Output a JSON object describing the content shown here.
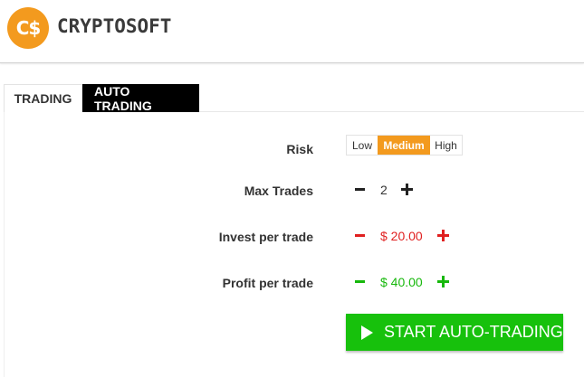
{
  "brand": {
    "badge": "C$",
    "name": "CRYPTOSOFT"
  },
  "tabs": [
    {
      "label": "TRADING",
      "active": false
    },
    {
      "label": "AUTO TRADING",
      "active": true
    }
  ],
  "settings": {
    "risk": {
      "label": "Risk",
      "options": [
        "Low",
        "Medium",
        "High"
      ],
      "selected": "Medium"
    },
    "max_trades": {
      "label": "Max Trades",
      "value": "2"
    },
    "invest": {
      "label": "Invest per trade",
      "value": "$ 20.00"
    },
    "profit": {
      "label": "Profit per trade",
      "value": "$ 40.00"
    }
  },
  "start_button": {
    "label": "START AUTO-TRADING"
  },
  "colors": {
    "accent_orange": "#f39a1e",
    "invest_red": "#e02020",
    "profit_green": "#17b80c",
    "button_green": "#17c10c"
  },
  "icons": [
    "minus-icon",
    "plus-icon",
    "play-icon"
  ]
}
